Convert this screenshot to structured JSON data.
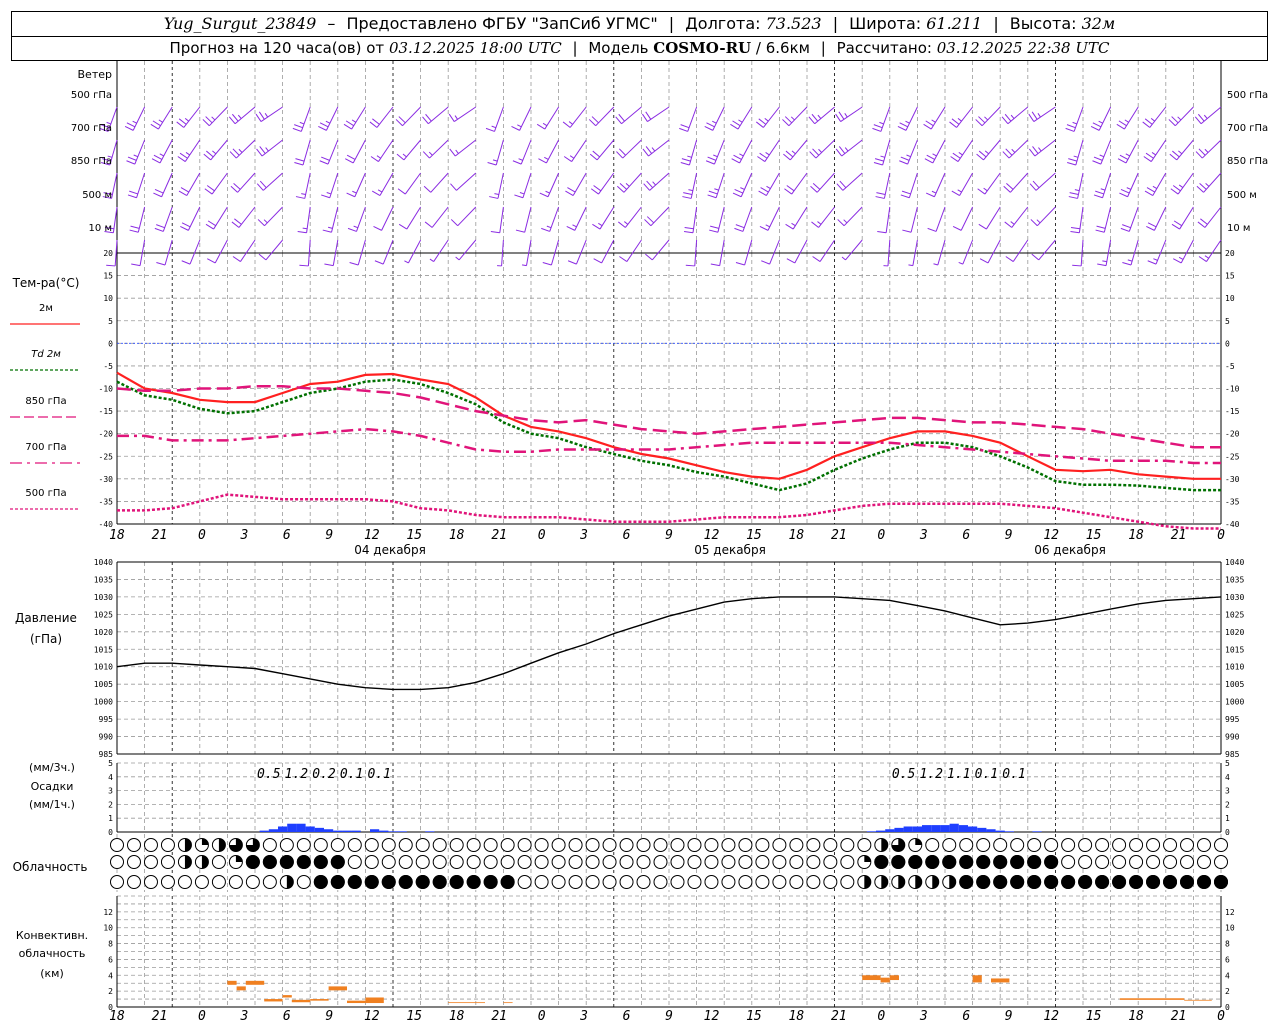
{
  "header": {
    "station": "Yug_Surgut_23849",
    "provider_text": "Предоставлено ФГБУ \"ЗапСиб УГМС\"",
    "lon_label": "Долгота:",
    "lon_value": "73.523",
    "lat_label": "Широта:",
    "lat_value": "61.211",
    "alt_label": "Высота:",
    "alt_value": "32м",
    "dash": "–",
    "forecast_label": "Прогноз на 120 часа(ов) от",
    "forecast_time": "03.12.2025 18:00 UTC",
    "model_label": "Модель",
    "model_name": "COSMO-RU",
    "model_res": "/ 6.6км",
    "calc_label": "Рассчитано:",
    "calc_time": "03.12.2025 22:38 UTC"
  },
  "labels": {
    "wind": "Ветер",
    "levels": [
      "500 гПа",
      "700 гПа",
      "850 гПа",
      "500 м",
      "10  м"
    ],
    "temp_title": "Тем-ра(°C)",
    "legend": [
      {
        "label": "2м",
        "color": "#ff2020",
        "style": "solid"
      },
      {
        "label": "Td  2м",
        "color": "#007000",
        "style": "dotted"
      },
      {
        "label": "850 гПа",
        "color": "#e0147a",
        "style": "dash"
      },
      {
        "label": "700 гПа",
        "color": "#e0147a",
        "style": "dashdot"
      },
      {
        "label": "500 гПа",
        "color": "#e0147a",
        "style": "dot"
      }
    ],
    "pressure_title": "Давление",
    "pressure_unit": "(гПа)",
    "precip_unit3": "(мм/3ч.)",
    "precip_title": "Осадки",
    "precip_unit1": "(мм/1ч.)",
    "cloud_title": "Облачность",
    "conv_title1": "Конвективн.",
    "conv_title2": "облачность",
    "conv_unit": "(км)",
    "dates": [
      "04 декабря",
      "05 декабря",
      "06 декабря"
    ],
    "time_ticks": [
      "18",
      "21",
      "0",
      "3",
      "6",
      "9",
      "12",
      "15",
      "18",
      "21",
      "0",
      "3",
      "6",
      "9",
      "12",
      "15",
      "18",
      "21",
      "0",
      "3",
      "6",
      "9",
      "12",
      "15",
      "18",
      "21",
      "0"
    ]
  },
  "colors": {
    "wind": "#8a2be2",
    "temp2m": "#ff2020",
    "dew": "#007000",
    "upper": "#e0147a",
    "precip": "#1f3fff",
    "conv": "#f08020",
    "grid": "#9a9a9a"
  },
  "chart_data": [
    {
      "type": "line",
      "title": "Тем-ра(°C)",
      "x_hours": [
        0,
        3,
        6,
        9,
        12,
        15,
        18,
        21,
        24,
        27,
        30,
        33,
        36,
        39,
        42,
        45,
        48,
        51,
        54,
        57,
        60,
        63,
        66,
        69,
        72,
        75,
        78,
        81,
        84,
        87,
        90,
        93,
        96,
        99,
        102,
        105,
        108,
        111,
        114,
        117,
        120
      ],
      "ylim": [
        -40,
        20
      ],
      "yticks": [
        20,
        15,
        10,
        5,
        0,
        -5,
        -10,
        -15,
        -20,
        -25,
        -30,
        -35,
        -40
      ],
      "series": [
        {
          "name": "2м",
          "values": [
            -6.5,
            -10,
            -11,
            -12.5,
            -13,
            -13,
            -11,
            -9,
            -8.5,
            -7,
            -6.8,
            -8,
            -9,
            -12,
            -16,
            -18.5,
            -19.5,
            -21,
            -23,
            -24.5,
            -25.5,
            -27,
            -28.5,
            -29.5,
            -30,
            -28,
            -25,
            -23,
            -21,
            -19.5,
            -19.5,
            -20.5,
            -22,
            -25,
            -28,
            -28.3,
            -28,
            -29,
            -29.5,
            -30,
            -30
          ]
        },
        {
          "name": "Td  2м",
          "values": [
            -8.5,
            -11.5,
            -12.5,
            -14.5,
            -15.5,
            -15,
            -13,
            -11,
            -10,
            -8.5,
            -8,
            -9,
            -11,
            -13.5,
            -17.5,
            -20,
            -21,
            -23,
            -24.5,
            -26,
            -27,
            -28.5,
            -29.5,
            -31,
            -32.5,
            -31,
            -28,
            -25.5,
            -23.5,
            -22,
            -22,
            -23,
            -25,
            -27.5,
            -30.5,
            -31.3,
            -31.3,
            -31.5,
            -32,
            -32.5,
            -32.5
          ]
        },
        {
          "name": "850 гПа",
          "values": [
            -10,
            -10.5,
            -10.5,
            -10,
            -10,
            -9.5,
            -9.5,
            -10,
            -10,
            -10.5,
            -11,
            -12,
            -13.5,
            -15,
            -16,
            -17,
            -17.5,
            -17,
            -18,
            -19,
            -19.5,
            -20,
            -19.5,
            -19,
            -18.5,
            -18,
            -17.5,
            -17,
            -16.5,
            -16.5,
            -17,
            -17.5,
            -17.5,
            -18,
            -18.5,
            -19,
            -20,
            -21,
            -22,
            -23,
            -23
          ]
        },
        {
          "name": "700 гПа",
          "values": [
            -20.5,
            -20.5,
            -21.5,
            -21.5,
            -21.5,
            -21,
            -20.5,
            -20,
            -19.5,
            -19,
            -19.5,
            -20.5,
            -22,
            -23.5,
            -24,
            -24,
            -23.5,
            -23.5,
            -23.5,
            -23.5,
            -23.5,
            -23,
            -22.5,
            -22,
            -22,
            -22,
            -22,
            -22,
            -22,
            -22.5,
            -23,
            -23.5,
            -24,
            -24.5,
            -25,
            -25.5,
            -26,
            -26,
            -26,
            -26.5,
            -26.5
          ]
        },
        {
          "name": "500 гПа",
          "values": [
            -37,
            -37,
            -36.5,
            -35,
            -33.5,
            -34,
            -34.5,
            -34.5,
            -34.5,
            -34.5,
            -35,
            -36.5,
            -37,
            -38,
            -38.5,
            -38.5,
            -38.5,
            -39,
            -39.5,
            -39.5,
            -39.5,
            -39,
            -38.5,
            -38.5,
            -38.5,
            -38,
            -37,
            -36,
            -35.5,
            -35.5,
            -35.5,
            -35.5,
            -35.5,
            -36,
            -36.5,
            -37.5,
            -38.5,
            -39.5,
            -40.5,
            -41,
            -41
          ]
        }
      ]
    },
    {
      "type": "line",
      "title": "Давление",
      "ylabel": "(гПа)",
      "x_hours": [
        0,
        3,
        6,
        9,
        12,
        15,
        18,
        21,
        24,
        27,
        30,
        33,
        36,
        39,
        42,
        45,
        48,
        51,
        54,
        57,
        60,
        63,
        66,
        69,
        72,
        75,
        78,
        81,
        84,
        87,
        90,
        93,
        96,
        99,
        102,
        105,
        108,
        111,
        114,
        117,
        120
      ],
      "ylim": [
        985,
        1040
      ],
      "yticks": [
        1040,
        1035,
        1030,
        1025,
        1020,
        1015,
        1010,
        1005,
        1000,
        995,
        990,
        985
      ],
      "series": [
        {
          "name": "Давление",
          "values": [
            1010,
            1011,
            1011,
            1010.5,
            1010,
            1009.5,
            1008,
            1006.5,
            1005,
            1004,
            1003.5,
            1003.5,
            1004,
            1005.5,
            1008,
            1011,
            1014,
            1016.5,
            1019.5,
            1022,
            1024.5,
            1026.5,
            1028.5,
            1029.5,
            1030,
            1030,
            1030,
            1029.5,
            1029,
            1027.5,
            1026,
            1024,
            1022,
            1022.5,
            1023.5,
            1025,
            1026.5,
            1028,
            1029,
            1029.5,
            1030
          ]
        }
      ]
    },
    {
      "type": "bar",
      "title": "Осадки",
      "ylim": [
        0,
        5
      ],
      "yticks": [
        5,
        4,
        3,
        2,
        1,
        0
      ],
      "hourly": [
        {
          "h": 16,
          "v": 0.1
        },
        {
          "h": 17,
          "v": 0.2
        },
        {
          "h": 18,
          "v": 0.4
        },
        {
          "h": 19,
          "v": 0.6
        },
        {
          "h": 20,
          "v": 0.6
        },
        {
          "h": 21,
          "v": 0.4
        },
        {
          "h": 22,
          "v": 0.3
        },
        {
          "h": 23,
          "v": 0.2
        },
        {
          "h": 24,
          "v": 0.1
        },
        {
          "h": 25,
          "v": 0.1
        },
        {
          "h": 26,
          "v": 0.1
        },
        {
          "h": 28,
          "v": 0.2
        },
        {
          "h": 29,
          "v": 0.1
        },
        {
          "h": 30,
          "v": 0.05
        },
        {
          "h": 31,
          "v": 0.05
        },
        {
          "h": 34,
          "v": 0.05
        },
        {
          "h": 82,
          "v": 0.05
        },
        {
          "h": 83,
          "v": 0.1
        },
        {
          "h": 84,
          "v": 0.2
        },
        {
          "h": 85,
          "v": 0.3
        },
        {
          "h": 86,
          "v": 0.4
        },
        {
          "h": 87,
          "v": 0.4
        },
        {
          "h": 88,
          "v": 0.5
        },
        {
          "h": 89,
          "v": 0.5
        },
        {
          "h": 90,
          "v": 0.5
        },
        {
          "h": 91,
          "v": 0.6
        },
        {
          "h": 92,
          "v": 0.5
        },
        {
          "h": 93,
          "v": 0.4
        },
        {
          "h": 94,
          "v": 0.3
        },
        {
          "h": 95,
          "v": 0.2
        },
        {
          "h": 96,
          "v": 0.1
        },
        {
          "h": 97,
          "v": 0.05
        },
        {
          "h": 100,
          "v": 0.05
        }
      ],
      "totals_3h": [
        {
          "h": 16.5,
          "label": "0.5"
        },
        {
          "h": 19.5,
          "label": "1.2"
        },
        {
          "h": 22.5,
          "label": "0.2"
        },
        {
          "h": 25.5,
          "label": "0.1"
        },
        {
          "h": 28.5,
          "label": "0.1"
        },
        {
          "h": 85.5,
          "label": "0.5"
        },
        {
          "h": 88.5,
          "label": "1.2"
        },
        {
          "h": 91.5,
          "label": "1.1"
        },
        {
          "h": 94.5,
          "label": "0.1"
        },
        {
          "h": 97.5,
          "label": "0.1"
        }
      ]
    },
    {
      "type": "bar",
      "title": "Конвективн. облачность",
      "ylabel": "(км)",
      "ylim": [
        0,
        14
      ],
      "yticks": [
        12,
        10,
        8,
        6,
        4,
        2,
        0
      ],
      "layers": [
        {
          "h0": 12,
          "h1": 13,
          "bottom": 2.8,
          "top": 3.3
        },
        {
          "h0": 13,
          "h1": 14,
          "bottom": 2.1,
          "top": 2.6
        },
        {
          "h0": 14,
          "h1": 16,
          "bottom": 2.8,
          "top": 3.3
        },
        {
          "h0": 16,
          "h1": 18,
          "bottom": 0.7,
          "top": 1.0
        },
        {
          "h0": 18,
          "h1": 19,
          "bottom": 1.2,
          "top": 1.5
        },
        {
          "h0": 19,
          "h1": 21,
          "bottom": 0.6,
          "top": 0.9
        },
        {
          "h0": 21,
          "h1": 23,
          "bottom": 0.8,
          "top": 1.0
        },
        {
          "h0": 23,
          "h1": 25,
          "bottom": 2.1,
          "top": 2.6
        },
        {
          "h0": 25,
          "h1": 27,
          "bottom": 0.5,
          "top": 0.8
        },
        {
          "h0": 27,
          "h1": 29,
          "bottom": 0.5,
          "top": 1.2
        },
        {
          "h0": 36,
          "h1": 40,
          "bottom": 0.5,
          "top": 0.6
        },
        {
          "h0": 42,
          "h1": 43,
          "bottom": 0.5,
          "top": 0.6
        },
        {
          "h0": 81,
          "h1": 83,
          "bottom": 3.4,
          "top": 4.0
        },
        {
          "h0": 83,
          "h1": 84,
          "bottom": 3.1,
          "top": 3.7
        },
        {
          "h0": 84,
          "h1": 85,
          "bottom": 3.4,
          "top": 4.0
        },
        {
          "h0": 93,
          "h1": 94,
          "bottom": 3.1,
          "top": 4.0
        },
        {
          "h0": 95,
          "h1": 97,
          "bottom": 3.1,
          "top": 3.6
        },
        {
          "h0": 109,
          "h1": 116,
          "bottom": 0.9,
          "top": 1.1
        },
        {
          "h0": 116,
          "h1": 119,
          "bottom": 0.8,
          "top": 0.9
        }
      ]
    }
  ],
  "wind_data": {
    "levels_kt": [
      [
        25,
        25,
        25,
        25,
        25,
        25,
        25,
        25,
        25,
        25,
        20,
        20,
        20,
        15,
        15,
        15,
        15,
        15,
        20,
        20,
        20,
        20,
        25,
        25,
        25,
        25,
        25,
        25,
        25,
        25,
        25,
        25,
        25,
        25,
        25,
        25,
        25,
        25,
        25,
        25,
        25,
        25
      ],
      [
        25,
        25,
        25,
        25,
        25,
        25,
        25,
        20,
        20,
        20,
        15,
        15,
        15,
        15,
        15,
        15,
        15,
        15,
        20,
        20,
        25,
        25,
        25,
        25,
        25,
        25,
        25,
        25,
        25,
        25,
        25,
        25,
        25,
        25,
        25,
        25,
        25,
        25,
        25,
        25,
        25,
        25
      ],
      [
        20,
        20,
        20,
        20,
        20,
        20,
        20,
        15,
        15,
        15,
        15,
        10,
        10,
        10,
        15,
        15,
        15,
        20,
        20,
        25,
        25,
        25,
        25,
        25,
        25,
        20,
        20,
        20,
        20,
        20,
        15,
        15,
        15,
        20,
        20,
        25,
        25,
        25,
        25,
        25,
        25,
        25
      ],
      [
        20,
        20,
        20,
        20,
        20,
        20,
        15,
        15,
        15,
        15,
        10,
        10,
        10,
        10,
        10,
        10,
        15,
        15,
        15,
        15,
        20,
        20,
        20,
        20,
        15,
        15,
        15,
        15,
        10,
        10,
        10,
        10,
        10,
        15,
        15,
        20,
        20,
        20,
        20,
        20,
        20,
        20
      ],
      [
        10,
        10,
        10,
        10,
        10,
        10,
        10,
        10,
        10,
        10,
        10,
        5,
        5,
        5,
        5,
        5,
        10,
        10,
        10,
        10,
        10,
        10,
        10,
        10,
        10,
        10,
        10,
        5,
        5,
        5,
        5,
        5,
        10,
        10,
        10,
        10,
        15,
        15,
        15,
        15,
        15,
        15
      ]
    ]
  },
  "cloud_data": {
    "rows": [
      "0000002212213310000000000000000000000000000000000000000000000000000000000002331000000000000000000000000000000",
      "0000000220001444444444400000000000000000000000000000000000000000000000003144444444444444444440000000000000000",
      "0000000000000000220444444444444444444444000000000000000000000000000000002222222222244444444444444444444444444"
    ]
  }
}
